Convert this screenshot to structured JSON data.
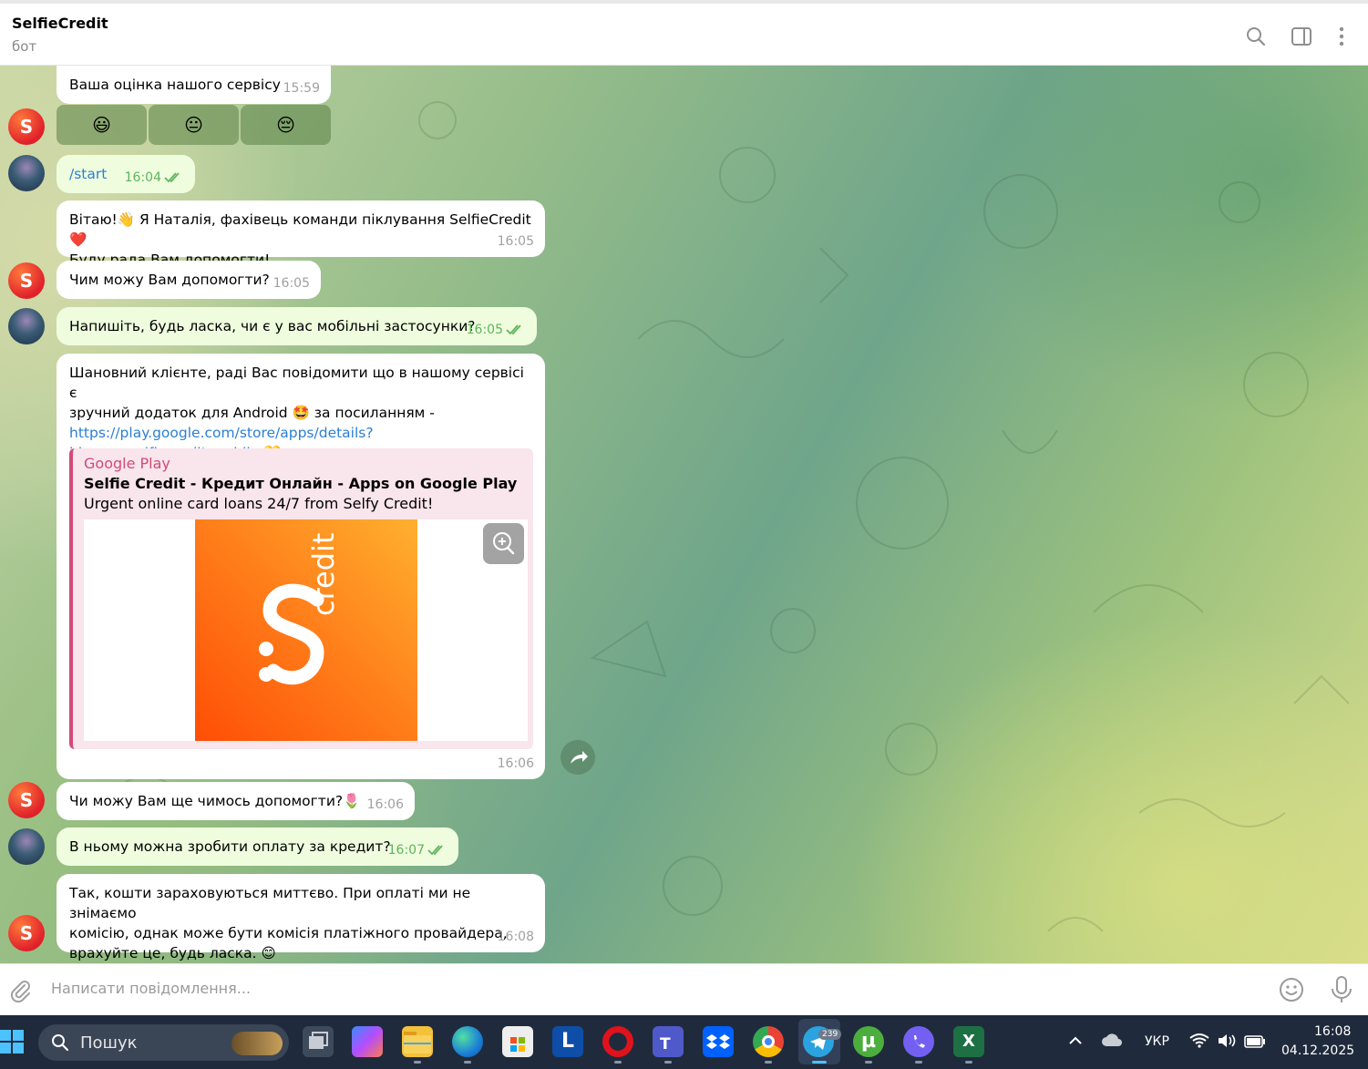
{
  "header": {
    "title": "SelfieCredit",
    "subtitle": "бот"
  },
  "messages": [
    {
      "id": "m1",
      "direction": "in",
      "text": "Ваша оцінка нашого сервісу",
      "time": "15:59",
      "keyboard": [
        "😃",
        "😐",
        "😔"
      ]
    },
    {
      "id": "m2",
      "direction": "out",
      "text": "/start",
      "time": "16:04"
    },
    {
      "id": "m3",
      "direction": "in",
      "text_line1": "Вітаю!👋 Я Наталія, фахівець команди піклування SelfieCredit❤️",
      "text_line2": "Буду рада Вам допомогти!",
      "time": "16:05"
    },
    {
      "id": "m4",
      "direction": "in",
      "text": "Чим можу Вам допомогти?",
      "time": "16:05"
    },
    {
      "id": "m5",
      "direction": "out",
      "text": "Напишіть, будь ласка, чи є у вас мобільні застосунки?",
      "time": "16:05"
    },
    {
      "id": "m6",
      "direction": "in",
      "text_line1": "Шановний клієнте, раді Вас повідомити що в нашому сервісі є",
      "text_line2": "зручний додаток для Android 🤩 за посиланням -",
      "link_line1": "https://play.google.com/store/apps/details?",
      "link_line2": "id=com.selfiecredit.mobile",
      "link_emoji": "💛",
      "preview": {
        "site": "Google Play",
        "title": "Selfie Credit - Кредит Онлайн - Apps on Google Play",
        "description": "Urgent online card loans 24/7 from Selfy Credit!",
        "logo_text": "credit"
      },
      "time": "16:06"
    },
    {
      "id": "m7",
      "direction": "in",
      "text": "Чи можу Вам ще чимось допомогти?🌷",
      "time": "16:06"
    },
    {
      "id": "m8",
      "direction": "out",
      "text": "В ньому можна зробити оплату за кредит?",
      "time": "16:07"
    },
    {
      "id": "m9",
      "direction": "in",
      "text_line1": "Так, кошти зараховуються миттєво. При оплаті ми не знімаємо",
      "text_line2": "комісію, однак може бути комісія платіжного провайдера,",
      "text_line3": "врахуйте це, будь ласка. 😊",
      "time": "16:08"
    }
  ],
  "composer": {
    "placeholder": "Написати повідомлення..."
  },
  "taskbar": {
    "search_label": "Пошук",
    "telegram_badge": "239",
    "language": "УКР",
    "time": "16:08",
    "date": "04.12.2025"
  },
  "colors": {
    "outgoing_bubble": "#effdde",
    "incoming_bubble": "#ffffff",
    "link": "#2b7fd4",
    "preview_accent": "#d14a78",
    "read_ticks": "#5fb45b"
  },
  "icons": {
    "header": [
      "search-icon",
      "sidebar-toggle-icon",
      "more-vertical-icon"
    ],
    "composer": [
      "attach-icon",
      "emoji-icon",
      "microphone-icon"
    ]
  }
}
